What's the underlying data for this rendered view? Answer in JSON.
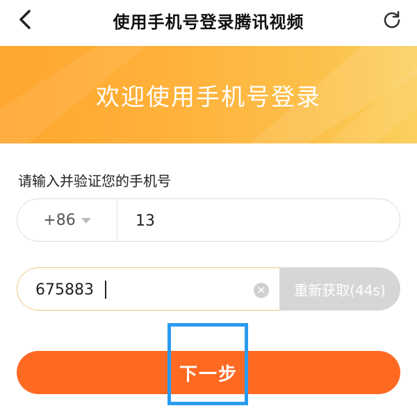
{
  "header": {
    "title": "使用手机号登录腾讯视频",
    "back_icon": "chevron-left-icon",
    "refresh_icon": "refresh-icon"
  },
  "banner": {
    "text": "欢迎使用手机号登录",
    "colors": [
      "#ffa62e",
      "#fbd05f"
    ]
  },
  "form": {
    "label": "请输入并验证您的手机号",
    "country_code": "+86",
    "phone_value": "13",
    "code_value": "675883",
    "clear_icon": "clear-icon",
    "resend_label": "重新获取(44s)"
  },
  "actions": {
    "next_label": "下一步",
    "next_color": "#ff6a23",
    "highlight_color": "#2a9bef"
  }
}
